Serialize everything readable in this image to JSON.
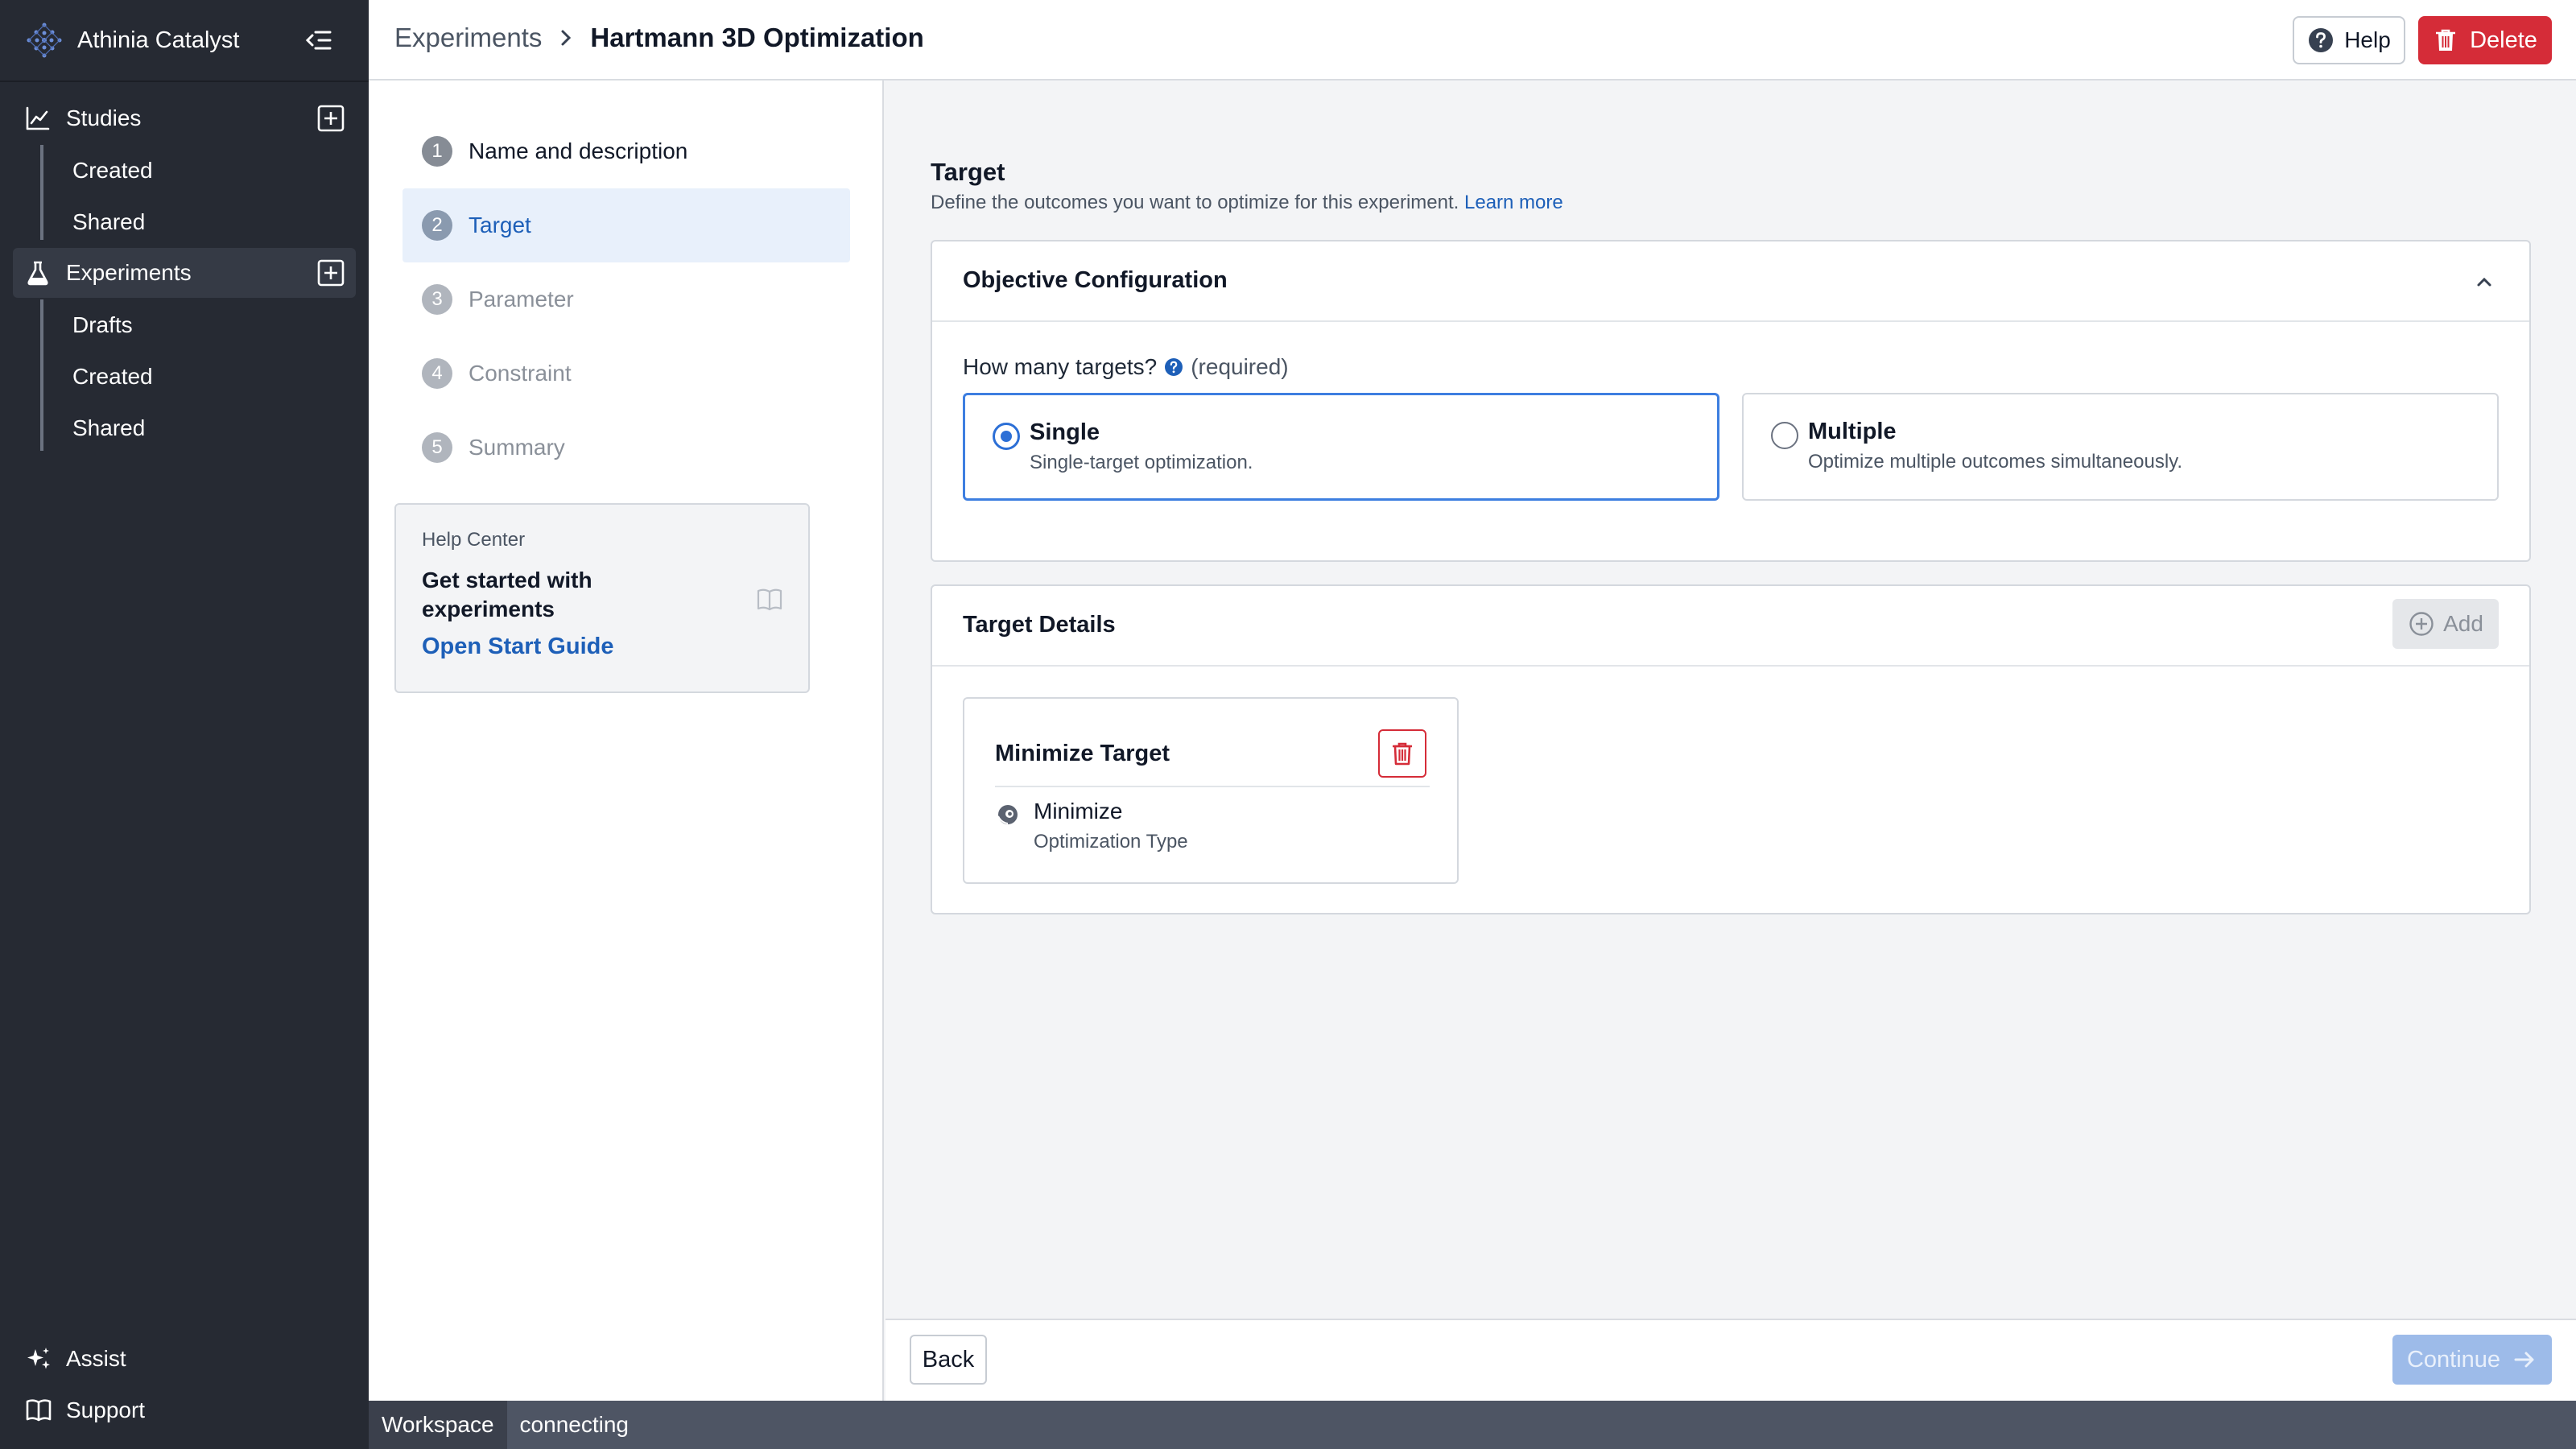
{
  "app": {
    "name": "Athinia Catalyst"
  },
  "sidebar": {
    "studies": {
      "label": "Studies",
      "items": [
        "Created",
        "Shared"
      ]
    },
    "experiments": {
      "label": "Experiments",
      "items": [
        "Drafts",
        "Created",
        "Shared"
      ]
    },
    "footer": {
      "assist": "Assist",
      "support": "Support"
    }
  },
  "header": {
    "breadcrumb_root": "Experiments",
    "breadcrumb_current": "Hartmann 3D Optimization",
    "help_label": "Help",
    "delete_label": "Delete"
  },
  "steps": [
    {
      "num": "1",
      "label": "Name and description",
      "state": "done"
    },
    {
      "num": "2",
      "label": "Target",
      "state": "active"
    },
    {
      "num": "3",
      "label": "Parameter",
      "state": "pending"
    },
    {
      "num": "4",
      "label": "Constraint",
      "state": "pending"
    },
    {
      "num": "5",
      "label": "Summary",
      "state": "pending"
    }
  ],
  "help_card": {
    "eyebrow": "Help Center",
    "title": "Get started with experiments",
    "link": "Open Start Guide"
  },
  "main": {
    "title": "Target",
    "subtitle": "Define the outcomes you want to optimize for this experiment.",
    "learn_more": "Learn more",
    "objective": {
      "title": "Objective Configuration",
      "question": "How many targets?",
      "required": "(required)",
      "options": [
        {
          "title": "Single",
          "desc": "Single-target optimization.",
          "selected": true
        },
        {
          "title": "Multiple",
          "desc": "Optimize multiple outcomes simultaneously.",
          "selected": false
        }
      ]
    },
    "details": {
      "title": "Target Details",
      "add_label": "Add",
      "target": {
        "title": "Minimize Target",
        "value": "Minimize",
        "label": "Optimization Type"
      }
    }
  },
  "footer_bar": {
    "back": "Back",
    "continue": "Continue"
  },
  "status": {
    "workspace": "Workspace",
    "state": "connecting"
  },
  "colors": {
    "primary": "#1d5fb8",
    "danger": "#d52c38",
    "sidebar": "#262a33"
  }
}
